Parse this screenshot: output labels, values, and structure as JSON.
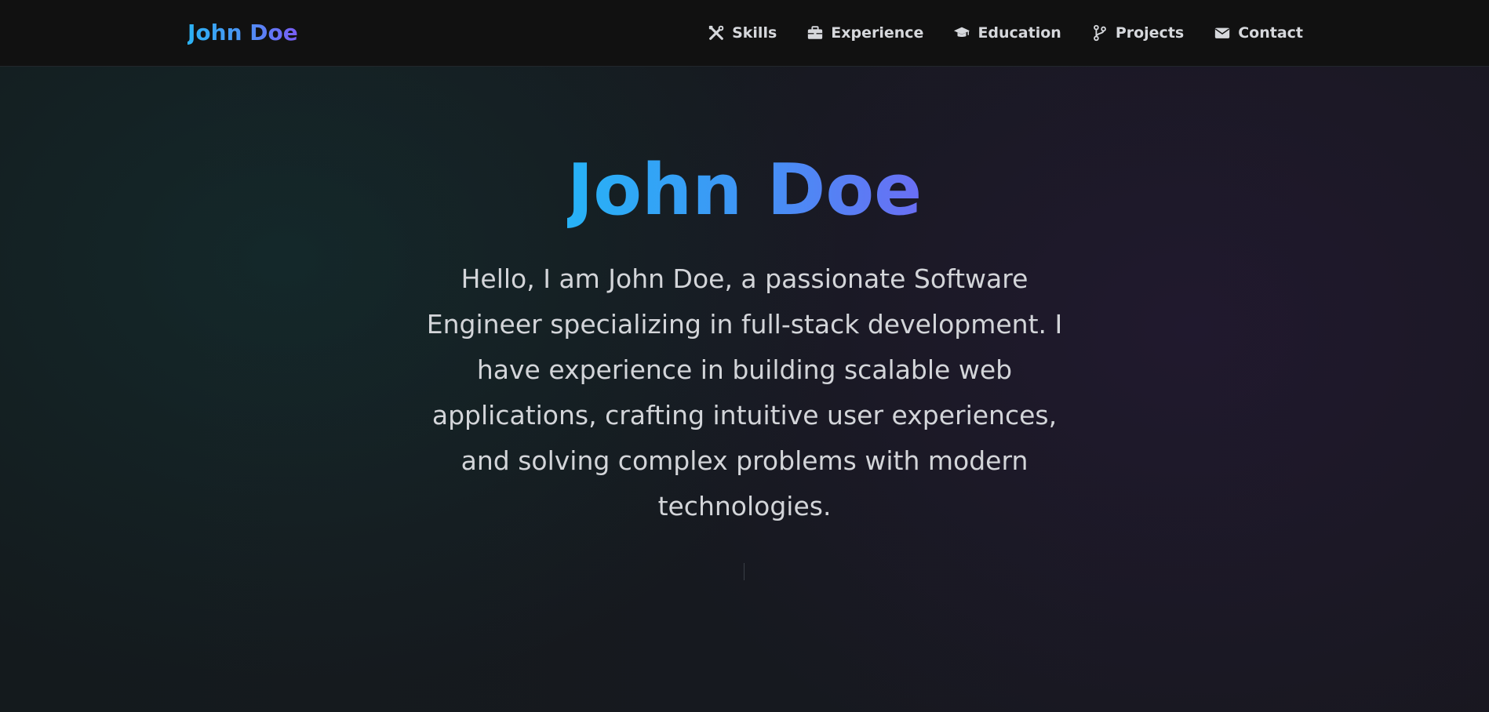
{
  "navbar": {
    "brand": "John Doe",
    "items": [
      {
        "label": "Skills",
        "icon": "tools-icon"
      },
      {
        "label": "Experience",
        "icon": "briefcase-icon"
      },
      {
        "label": "Education",
        "icon": "graduation-cap-icon"
      },
      {
        "label": "Projects",
        "icon": "code-branch-icon"
      },
      {
        "label": "Contact",
        "icon": "envelope-icon"
      }
    ]
  },
  "hero": {
    "title": "John Doe",
    "description": "Hello, I am John Doe, a passionate Software Engineer specializing in full-stack development. I have experience in building scalable web applications, crafting intuitive user experiences, and solving complex problems with modern technologies."
  },
  "colors": {
    "background": "#15171c",
    "navbar": "#111111",
    "gradient_start": "#27b2f6",
    "gradient_end": "#6a6ef4",
    "text": "#d3d5d9"
  }
}
